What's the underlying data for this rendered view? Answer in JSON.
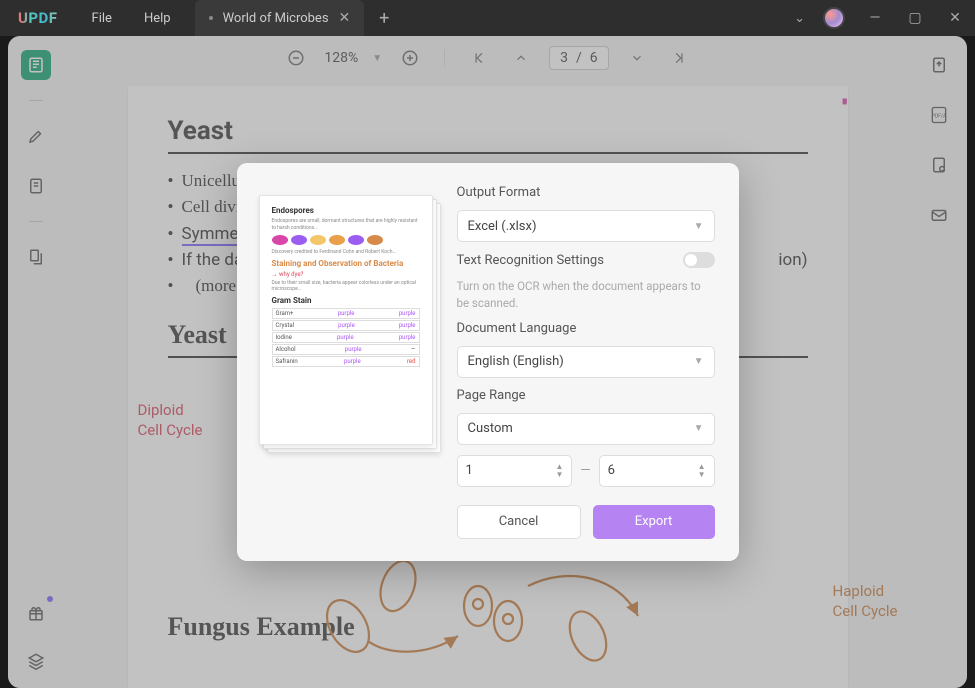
{
  "app": {
    "logo": "UPDF"
  },
  "menu": {
    "file": "File",
    "help": "Help"
  },
  "tab": {
    "title": "World of Microbes"
  },
  "toolbar": {
    "zoom": "128%",
    "page_current": "3",
    "page_sep": "/",
    "page_total": "6"
  },
  "document": {
    "heading1": "Yeast",
    "bullets": [
      "Unicellu",
      "Cell divis",
      "Symmet",
      "If the dau",
      "(more co"
    ],
    "bullet_tail": "ion)",
    "heading2": "Yeast",
    "heading3": "Fungus Example",
    "note_left_1": "Diploid",
    "note_left_2": "Cell Cycle",
    "note_right_1": "Haploid",
    "note_right_2": "Cell Cycle"
  },
  "dialog": {
    "output_format_label": "Output Format",
    "output_format_value": "Excel (.xlsx)",
    "ocr_label": "Text Recognition Settings",
    "ocr_hint": "Turn on the OCR when the document appears to be scanned.",
    "lang_label": "Document Language",
    "lang_value": "English (English)",
    "range_label": "Page Range",
    "range_value": "Custom",
    "range_from": "1",
    "range_to": "6",
    "cancel": "Cancel",
    "export": "Export"
  },
  "preview": {
    "h1": "Endospores",
    "h2": "Staining and Observation of Bacteria",
    "why": "why dye?",
    "h3": "Gram Stain",
    "col1": "purple",
    "col2": "purple",
    "col3": "red"
  }
}
